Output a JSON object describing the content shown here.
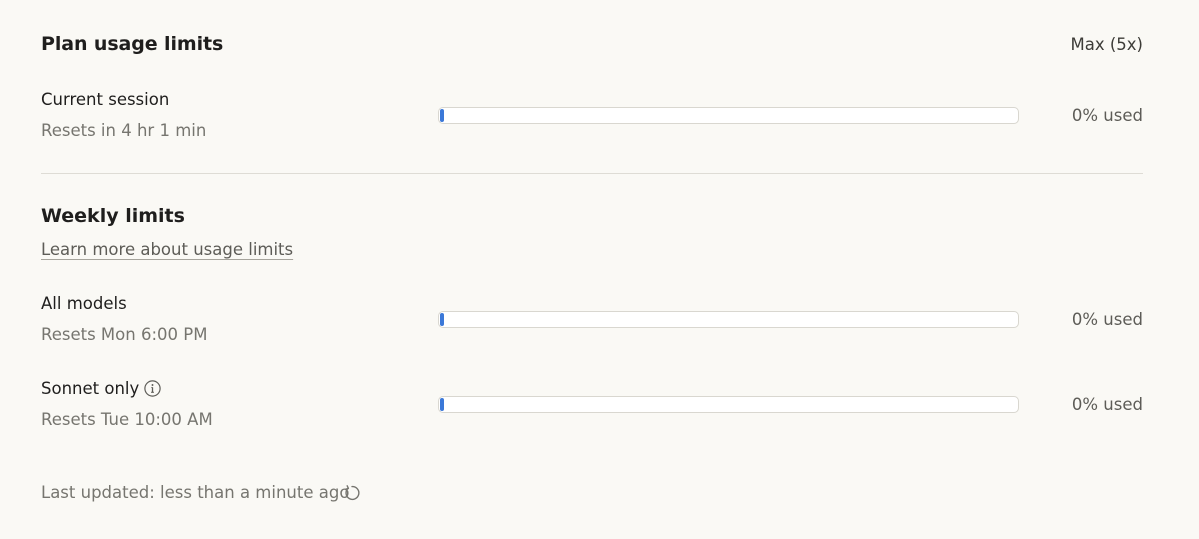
{
  "plan": {
    "title": "Plan usage limits",
    "tier": "Max (5x)"
  },
  "current_session": {
    "label": "Current session",
    "reset": "Resets in 4 hr 1 min",
    "used_fraction": 0,
    "used_text": "0% used"
  },
  "weekly": {
    "title": "Weekly limits",
    "learn_more": "Learn more about usage limits",
    "rows": [
      {
        "label": "All models",
        "reset": "Resets Mon 6:00 PM",
        "used_fraction": 0,
        "used_text": "0% used"
      },
      {
        "label": "Sonnet only",
        "reset": "Resets Tue 10:00 AM",
        "used_fraction": 0,
        "used_text": "0% used"
      }
    ]
  },
  "footer": {
    "last_updated": "Last updated: less than a minute ago"
  },
  "icons": {
    "info": "info-icon",
    "refresh": "refresh-icon"
  },
  "colors": {
    "accent": "#3b78d8",
    "background": "#faf9f5"
  }
}
